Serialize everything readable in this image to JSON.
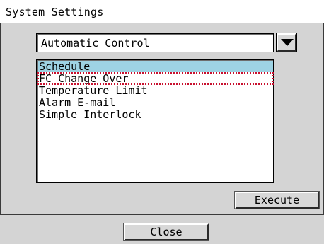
{
  "window": {
    "title": "System Settings"
  },
  "dropdown": {
    "selected_value": "Automatic Control",
    "arrow_icon": "triangle-down-icon"
  },
  "list": {
    "items": [
      {
        "label": "Schedule",
        "selected": true
      },
      {
        "label": "FC Change Over",
        "focused": true
      },
      {
        "label": "Temperature Limit"
      },
      {
        "label": "Alarm E-mail"
      },
      {
        "label": "Simple Interlock"
      }
    ],
    "selection_color": "#9ed3e4",
    "focus_outline_color": "#c8102e"
  },
  "buttons": {
    "execute_label": "Execute",
    "close_label": "Close"
  }
}
